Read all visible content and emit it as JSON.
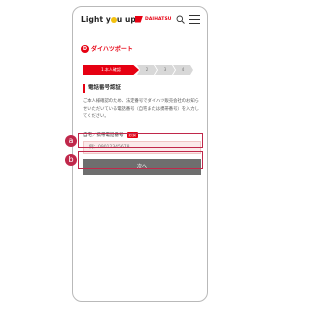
{
  "brand": {
    "prefix": "Light y",
    "suffix": "u up"
  },
  "daihatsu": {
    "label": "DAIHATSU"
  },
  "pass": {
    "mark": "D",
    "label": "ダイハツポート"
  },
  "steps": [
    {
      "label": "1.本人確認"
    },
    {
      "label": "2"
    },
    {
      "label": "3"
    },
    {
      "label": "4"
    }
  ],
  "section": {
    "title": "電話番号認証",
    "description": "ご本人様確認のため、法定番号でダイハツ販売会社のお知らせいただいている電話番号（自宅または携帯番号）を入力してください。"
  },
  "field": {
    "label": "自宅／携帯電話番号",
    "required": "必須",
    "placeholder": "例：09012345678"
  },
  "button": {
    "label": "次へ"
  },
  "annotations": {
    "a": "a",
    "b": "b"
  },
  "colors": {
    "accent": "#e60012",
    "annotation": "#c0284b",
    "button": "#6e6e6e"
  }
}
